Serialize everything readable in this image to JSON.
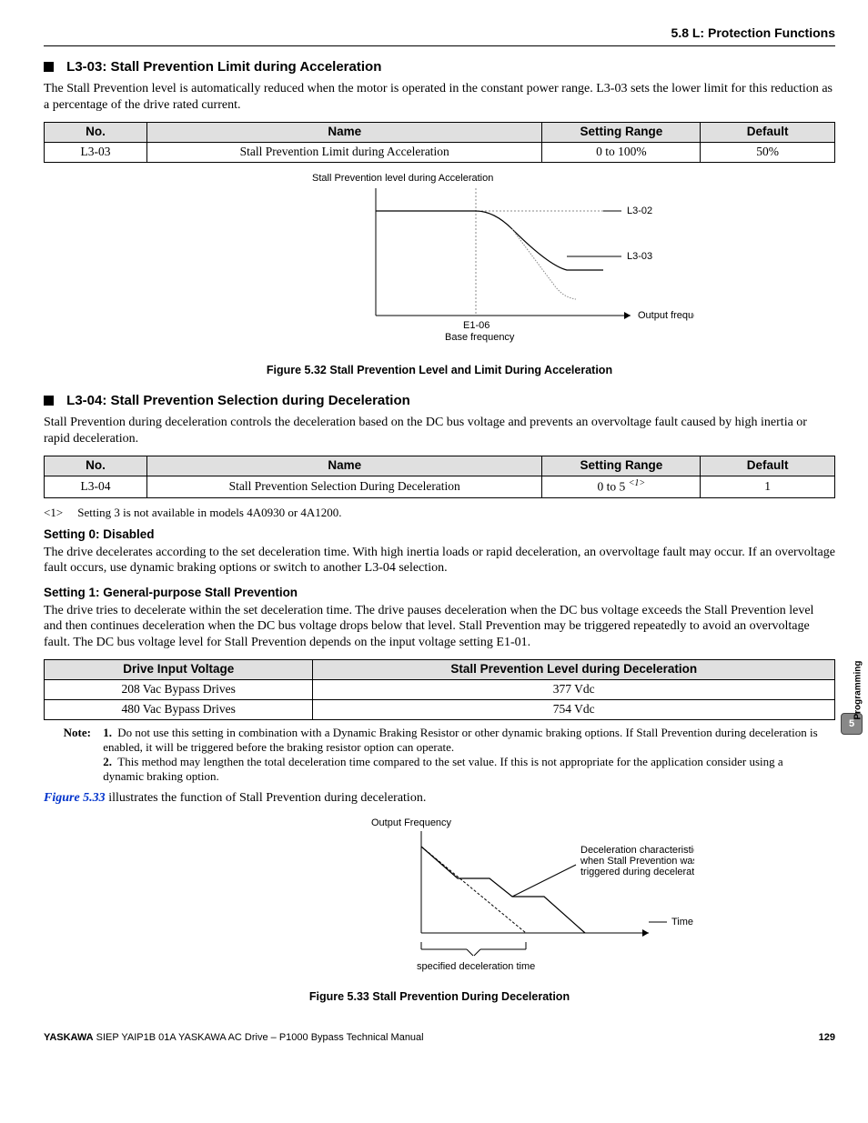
{
  "header": {
    "section": "5.8 L: Protection Functions"
  },
  "sec1": {
    "title": "L3-03: Stall Prevention Limit during Acceleration",
    "para": "The Stall Prevention level is automatically reduced when the motor is operated in the constant power range. L3-03 sets the lower limit for this reduction as a percentage of the drive rated current.",
    "table": {
      "headers": {
        "no": "No.",
        "name": "Name",
        "range": "Setting Range",
        "def": "Default"
      },
      "row": {
        "no": "L3-03",
        "name": "Stall Prevention Limit during Acceleration",
        "range": "0 to 100%",
        "def": "50%"
      }
    },
    "fig": {
      "y_label": "Stall Prevention level during Acceleration",
      "l302": "L3-02",
      "l303": "L3-03",
      "x_axis": "Output frequency",
      "x_tick": "E1-06",
      "x_tick2": "Base frequency",
      "caption": "Figure 5.32  Stall Prevention Level and Limit During Acceleration"
    }
  },
  "sec2": {
    "title": "L3-04: Stall Prevention Selection during Deceleration",
    "para": "Stall Prevention during deceleration controls the deceleration based on the DC bus voltage and prevents an overvoltage fault caused by high inertia or rapid deceleration.",
    "table": {
      "headers": {
        "no": "No.",
        "name": "Name",
        "range": "Setting Range",
        "def": "Default"
      },
      "row": {
        "no": "L3-04",
        "name": "Stall Prevention Selection During Deceleration",
        "range_pre": "0 to 5 ",
        "range_sup": "<1>",
        "def": "1"
      }
    },
    "foot1": {
      "tag": "<1>",
      "text": "Setting 3 is not available in models 4A0930 or 4A1200."
    },
    "set0": {
      "head": "Setting 0: Disabled",
      "text": "The drive decelerates according to the set deceleration time. With high inertia loads or rapid deceleration, an overvoltage fault may occur. If an overvoltage fault occurs, use dynamic braking options or switch to another L3-04 selection."
    },
    "set1": {
      "head": "Setting 1: General-purpose Stall Prevention",
      "text": "The drive tries to decelerate within the set deceleration time. The drive pauses deceleration when the DC bus voltage exceeds the Stall Prevention level and then continues deceleration when the DC bus voltage drops below that level. Stall Prevention may be triggered repeatedly to avoid an overvoltage fault. The DC bus voltage level for Stall Prevention depends on the input voltage setting E1-01."
    },
    "vtable": {
      "h1": "Drive Input Voltage",
      "h2": "Stall Prevention Level during Deceleration",
      "r1c1": "208 Vac Bypass Drives",
      "r1c2": "377 Vdc",
      "r2c1": "480 Vac Bypass Drives",
      "r2c2": "754 Vdc"
    },
    "note": {
      "label": "Note:",
      "n1": "Do not use this setting in combination with a Dynamic Braking Resistor or other dynamic braking options. If Stall Prevention during deceleration is enabled, it will be triggered before the braking resistor option can operate.",
      "n2": "This method may lengthen the total deceleration time compared to the set value. If this is not appropriate for the application consider using a dynamic braking option."
    },
    "line_after": {
      "ref": "Figure 5.33",
      "rest": " illustrates the function of Stall Prevention during deceleration."
    },
    "fig": {
      "y_label": "Output Frequency",
      "anno1": "Deceleration characteristics",
      "anno2": "when Stall Prevention was",
      "anno3": "triggered during deceleration",
      "x_axis": "Time",
      "brace": "specified deceleration time",
      "caption": "Figure 5.33  Stall Prevention During Deceleration"
    }
  },
  "side": {
    "label": "Programming",
    "num": "5"
  },
  "footer": {
    "left": "YASKAWA",
    "mid": " SIEP YAIP1B 01A YASKAWA AC Drive – P1000 Bypass Technical Manual",
    "page": "129"
  }
}
